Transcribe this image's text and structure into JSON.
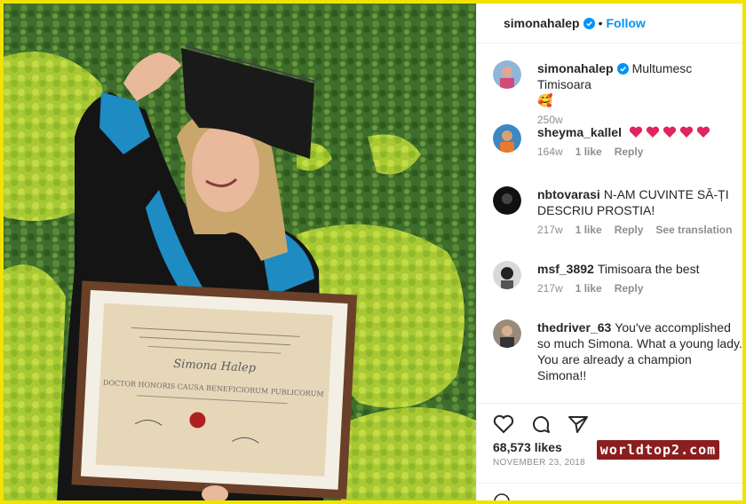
{
  "header": {
    "username": "simonahalep",
    "separator": "•",
    "follow_label": "Follow"
  },
  "caption": {
    "username": "simonahalep",
    "text": "Multumesc Timisoara",
    "emoji": "🥰",
    "time": "250w"
  },
  "comments": [
    {
      "username": "sheyma_kallel",
      "text": "",
      "hearts": 5,
      "time": "164w",
      "likes": "1 like",
      "reply": "Reply"
    },
    {
      "username": "nbtovarasi",
      "text": "N-AM CUVINTE SĂ-ȚI DESCRIU PROSTIA!",
      "time": "217w",
      "likes": "1 like",
      "reply": "Reply",
      "translate": "See translation"
    },
    {
      "username": "msf_3892",
      "text": "Timisoara the best",
      "time": "217w",
      "likes": "1 like",
      "reply": "Reply"
    },
    {
      "username": "thedriver_63",
      "text": "You've accomplished so much Simona. What a young lady. You are already a champion Simona!!",
      "time": "",
      "likes": "",
      "reply": ""
    }
  ],
  "post": {
    "likes": "68,573 likes",
    "date": "NOVEMBER 23, 2018"
  },
  "certificate": {
    "title": "DOCTOR HONORIS CAUSA BENEFICIORUM PUBLICORUM",
    "name": "Simona Halep"
  },
  "watermark": "worldtop2.com",
  "colors": {
    "accent": "#0095f6",
    "heart": "#ed4956",
    "frame": "#f2e200",
    "watermark_bg": "#8b1e1e"
  }
}
